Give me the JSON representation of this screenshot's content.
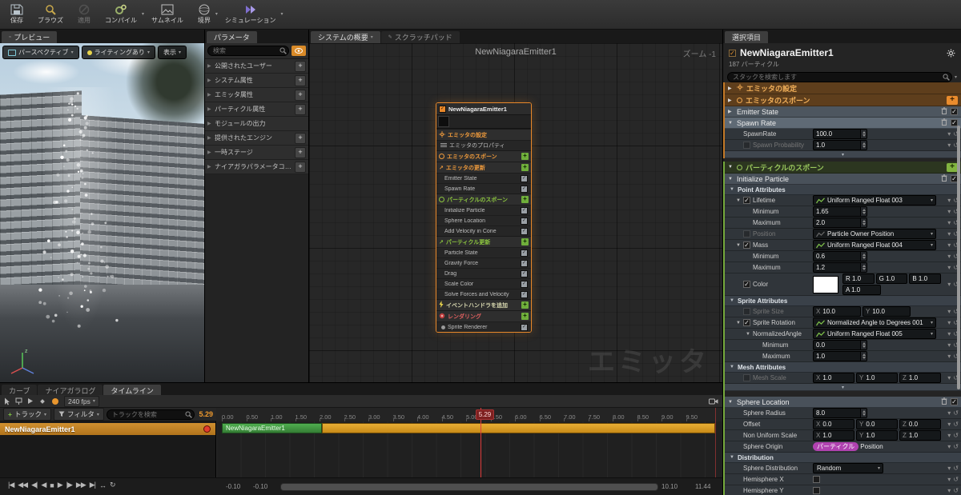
{
  "toolbar": {
    "items": [
      {
        "label": "保存",
        "icon": "save-icon"
      },
      {
        "label": "ブラウズ",
        "icon": "browse-icon"
      },
      {
        "label": "適用",
        "icon": "apply-icon",
        "disabled": true
      },
      {
        "label": "コンパイル",
        "icon": "compile-icon",
        "dropdown": true
      },
      {
        "label": "サムネイル",
        "icon": "thumbnail-icon"
      },
      {
        "label": "境界",
        "icon": "bounds-icon",
        "dropdown": true
      },
      {
        "label": "シミュレーション",
        "icon": "simulation-icon",
        "dropdown": true
      }
    ]
  },
  "preview": {
    "tab": "プレビュー",
    "buttons": [
      {
        "label": "パースペクティブ",
        "icon": "perspective-icon"
      },
      {
        "label": "ライティングあり",
        "icon": "lit-icon"
      },
      {
        "label": "表示",
        "icon": ""
      }
    ]
  },
  "parameters": {
    "tab": "パラメータ",
    "search_placeholder": "検索",
    "sections": [
      {
        "label": "公開されたユーザー",
        "plus": true
      },
      {
        "label": "システム属性",
        "plus": true
      },
      {
        "label": "エミッタ属性",
        "plus": true
      },
      {
        "label": "パーティクル属性",
        "plus": true
      },
      {
        "label": "モジュールの出力",
        "plus": false
      },
      {
        "label": "提供されたエンジン",
        "plus": true
      },
      {
        "label": "一時ステージ",
        "plus": true
      },
      {
        "label": "ナイアガラパラメータコレクション",
        "plus": true
      }
    ]
  },
  "graph": {
    "tab_overview": "システムの概要",
    "tab_scratch": "スクラッチパッド",
    "title": "NewNiagaraEmitter1",
    "zoom_label": "ズーム -1",
    "watermark": "エミッタ",
    "node": {
      "title": "NewNiagaraEmitter1",
      "rows": [
        {
          "kind": "group",
          "color": "orange",
          "icon": "gear",
          "label": "エミッタの設定"
        },
        {
          "kind": "item",
          "icon": "prop",
          "label": "エミッタのプロパティ"
        },
        {
          "kind": "group",
          "color": "orange",
          "icon": "circle",
          "label": "エミッタのスポーン",
          "plus": true
        },
        {
          "kind": "group",
          "color": "orange",
          "icon": "arrow",
          "label": "エミッタの更新",
          "plus": true
        },
        {
          "kind": "item",
          "check": true,
          "label": "Emitter State"
        },
        {
          "kind": "item",
          "check": true,
          "label": "Spawn Rate"
        },
        {
          "kind": "group",
          "color": "green",
          "icon": "circle",
          "label": "パーティクルのスポーン",
          "plus": true
        },
        {
          "kind": "item",
          "check": true,
          "label": "Initialize Particle"
        },
        {
          "kind": "item",
          "check": true,
          "label": "Sphere Location"
        },
        {
          "kind": "item",
          "check": true,
          "label": "Add Velocity in Cone"
        },
        {
          "kind": "group",
          "color": "green",
          "icon": "arrow",
          "label": "パーティクル更新",
          "plus": true
        },
        {
          "kind": "item",
          "check": true,
          "label": "Particle State"
        },
        {
          "kind": "item",
          "check": true,
          "label": "Gravity Force"
        },
        {
          "kind": "item",
          "check": true,
          "label": "Drag"
        },
        {
          "kind": "item",
          "check": true,
          "label": "Scale Color"
        },
        {
          "kind": "item",
          "check": true,
          "label": "Solve Forces and Velocity"
        },
        {
          "kind": "group",
          "color": "yellow",
          "icon": "bolt",
          "label": "イベントハンドラを追加",
          "plus": true
        },
        {
          "kind": "group",
          "color": "red",
          "icon": "render",
          "label": "レンダリング",
          "plus": true
        },
        {
          "kind": "item",
          "check": true,
          "icon": "dot",
          "label": "Sprite Renderer"
        }
      ]
    }
  },
  "selection": {
    "tab": "選択項目",
    "title": "NewNiagaraEmitter1",
    "particle_count": "187 パーティクル",
    "search_placeholder": "スタックを検索します",
    "stack_groups": [
      {
        "accent": "#c47a28",
        "rows": [
          {
            "t": "cat",
            "color": "orange",
            "icon": "gear",
            "label": "エミッタの設定",
            "expanded": false
          },
          {
            "t": "cat",
            "color": "orange",
            "icon": "circle",
            "label": "エミッタのスポーン",
            "plus": true
          },
          {
            "t": "cat",
            "color": "orange",
            "icon": "arrow",
            "label": "エミッタの更新",
            "plus": true,
            "selected": true,
            "expanded": true
          },
          {
            "t": "mod",
            "label": "Emitter State",
            "bg": "#4d565f"
          },
          {
            "t": "mod",
            "label": "Spawn Rate",
            "bg": "#5f6a75",
            "expanded": true
          },
          {
            "t": "num",
            "label": "SpawnRate",
            "value": "100.0"
          },
          {
            "t": "num",
            "label": "Spawn Probability",
            "value": "1.0",
            "dim": true,
            "check": "off"
          },
          {
            "t": "chev"
          }
        ]
      },
      {
        "accent": "#76aa3d",
        "rows": [
          {
            "t": "cat",
            "color": "green",
            "icon": "circle",
            "label": "パーティクルのスポーン",
            "plus": true,
            "expanded": true
          },
          {
            "t": "mod",
            "label": "Initialize Particle",
            "bg": "#49515a",
            "expanded": true
          },
          {
            "t": "sub",
            "label": "Point Attributes"
          },
          {
            "t": "dyn",
            "label": "Lifetime",
            "value": "Uniform Ranged Float 003",
            "check": "on",
            "expanded": true
          },
          {
            "t": "num",
            "label": "Minimum",
            "value": "1.65",
            "indent": 1
          },
          {
            "t": "num",
            "label": "Maximum",
            "value": "2.0",
            "indent": 1
          },
          {
            "t": "dyn",
            "label": "Position",
            "value": "Particle Owner Position",
            "check": "off",
            "dim": true
          },
          {
            "t": "dyn",
            "label": "Mass",
            "value": "Uniform Ranged Float 004",
            "check": "on",
            "expanded": true
          },
          {
            "t": "num",
            "label": "Minimum",
            "value": "0.6",
            "indent": 1
          },
          {
            "t": "num",
            "label": "Maximum",
            "value": "1.2",
            "indent": 1
          },
          {
            "t": "color",
            "label": "Color",
            "check": "on",
            "swatch": "#ffffff",
            "r": "R 1.0",
            "g": "G 1.0",
            "b": "B 1.0",
            "a": "A 1.0"
          },
          {
            "t": "sub",
            "label": "Sprite Attributes"
          },
          {
            "t": "vec",
            "label": "Sprite Size",
            "check": "off",
            "dim": true,
            "comps": [
              {
                "axis": "X",
                "value": "10.0"
              },
              {
                "axis": "Y",
                "value": "10.0"
              }
            ]
          },
          {
            "t": "dyn",
            "label": "Sprite Rotation",
            "value": "Normalized Angle to Degrees 001",
            "check": "on",
            "expanded": true
          },
          {
            "t": "dyn",
            "label": "NormalizedAngle",
            "value": "Uniform Ranged Float 005",
            "indent": 1,
            "expanded": true
          },
          {
            "t": "num",
            "label": "Minimum",
            "value": "0.0",
            "indent": 2
          },
          {
            "t": "num",
            "label": "Maximum",
            "value": "1.0",
            "indent": 2
          },
          {
            "t": "sub",
            "label": "Mesh Attributes"
          },
          {
            "t": "vec",
            "label": "Mesh Scale",
            "check": "off",
            "dim": true,
            "comps": [
              {
                "axis": "X",
                "value": "1.0"
              },
              {
                "axis": "Y",
                "value": "1.0"
              },
              {
                "axis": "Z",
                "value": "1.0"
              }
            ]
          },
          {
            "t": "chev"
          },
          {
            "t": "mod",
            "label": "Sphere Location",
            "bg": "#49515a",
            "expanded": true,
            "gap": true
          },
          {
            "t": "num",
            "label": "Sphere Radius",
            "value": "8.0"
          },
          {
            "t": "vec",
            "label": "Offset",
            "comps": [
              {
                "axis": "X",
                "value": "0.0"
              },
              {
                "axis": "Y",
                "value": "0.0"
              },
              {
                "axis": "Z",
                "value": "0.0"
              }
            ]
          },
          {
            "t": "vec",
            "label": "Non Uniform Scale",
            "comps": [
              {
                "axis": "X",
                "value": "1.0"
              },
              {
                "axis": "Y",
                "value": "1.0"
              },
              {
                "axis": "Z",
                "value": "1.0"
              }
            ]
          },
          {
            "t": "chip",
            "label": "Sphere Origin",
            "chip": "パーティクル",
            "value": "Position"
          },
          {
            "t": "sub",
            "label": "Distribution"
          },
          {
            "t": "sel",
            "label": "Sphere Distribution",
            "value": "Random"
          },
          {
            "t": "check",
            "label": "Hemisphere X"
          },
          {
            "t": "check",
            "label": "Hemisphere Y"
          }
        ]
      }
    ]
  },
  "timeline": {
    "tabs": [
      {
        "label": "カーブ",
        "active": false
      },
      {
        "label": "ナイアガラログ",
        "active": false
      },
      {
        "label": "タイムライン",
        "active": true
      }
    ],
    "toolbar_icons": [
      "select-tool-icon",
      "marker-icon",
      "play-small-icon",
      "keyframe-icon",
      "auto-key-icon"
    ],
    "fps_label": "240 fps",
    "camera_lock_icon": "camera-lock-icon",
    "add_track_label": "トラック",
    "filter_label": "フィルタ",
    "search_placeholder": "トラックを検索",
    "current_time": "5.29",
    "track_name": "NewNiagaraEmitter1",
    "ruler_ticks": [
      "0.00",
      "0.50",
      "1.00",
      "1.50",
      "2.00",
      "2.50",
      "3.00",
      "3.50",
      "4.00",
      "4.50",
      "5.00",
      "5.50",
      "6.00",
      "6.50",
      "7.00",
      "7.50",
      "8.00",
      "8.50",
      "9.00",
      "9.50"
    ],
    "playhead": {
      "label": "5.29",
      "value": 5.29
    },
    "bars": {
      "green_start": 0,
      "green_end": 2.05,
      "orange_end": 10.1
    },
    "scroll": {
      "range_start": "-0.10",
      "view_start": "-0.10",
      "range_end": "10.10",
      "view_end": "11.44"
    },
    "playback_icons": [
      "go-to-front",
      "jump-back",
      "step-back",
      "play-reverse",
      "stop",
      "play",
      "step-forward",
      "jump-forward",
      "go-to-end",
      "play-range",
      "loop"
    ]
  }
}
